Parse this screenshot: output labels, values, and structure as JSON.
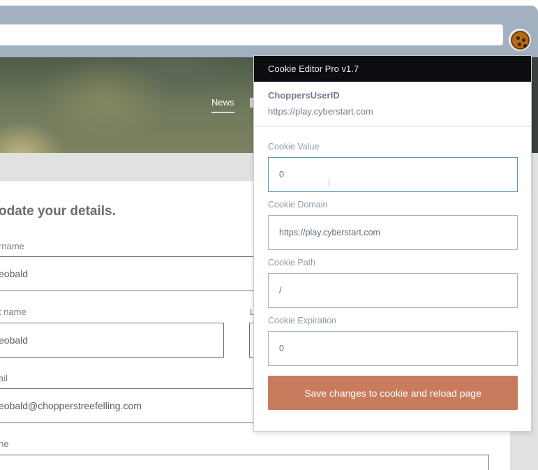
{
  "browser": {
    "url": "",
    "extension_icon": "cookie-icon"
  },
  "site": {
    "nav": {
      "news": "News"
    },
    "form": {
      "title": "odate your details.",
      "username_label": "rname",
      "username_value": "eobald",
      "firstname_label": "t name",
      "firstname_value": "eobald",
      "lastname_label": "L",
      "email_label": "ail",
      "email_value": "eobald@chopperstreefelling.com",
      "phone_label": "ne"
    }
  },
  "popup": {
    "title": "Cookie Editor Pro v1.7",
    "cookie_name": "ChoppersUserID",
    "cookie_url": "https://play.cyberstart.com",
    "fields": {
      "value_label": "Cookie Value",
      "value": "0",
      "domain_label": "Cookie Domain",
      "domain": "https://play.cyberstart.com",
      "path_label": "Cookie Path",
      "path": "/",
      "expiration_label": "Cookie Expiration",
      "expiration": "0"
    },
    "save_label": "Save changes to cookie and reload page",
    "colors": {
      "header_bg": "#0b0d10",
      "button_bg": "#c87b5d",
      "chrome_bg": "#a2b0bf"
    }
  }
}
